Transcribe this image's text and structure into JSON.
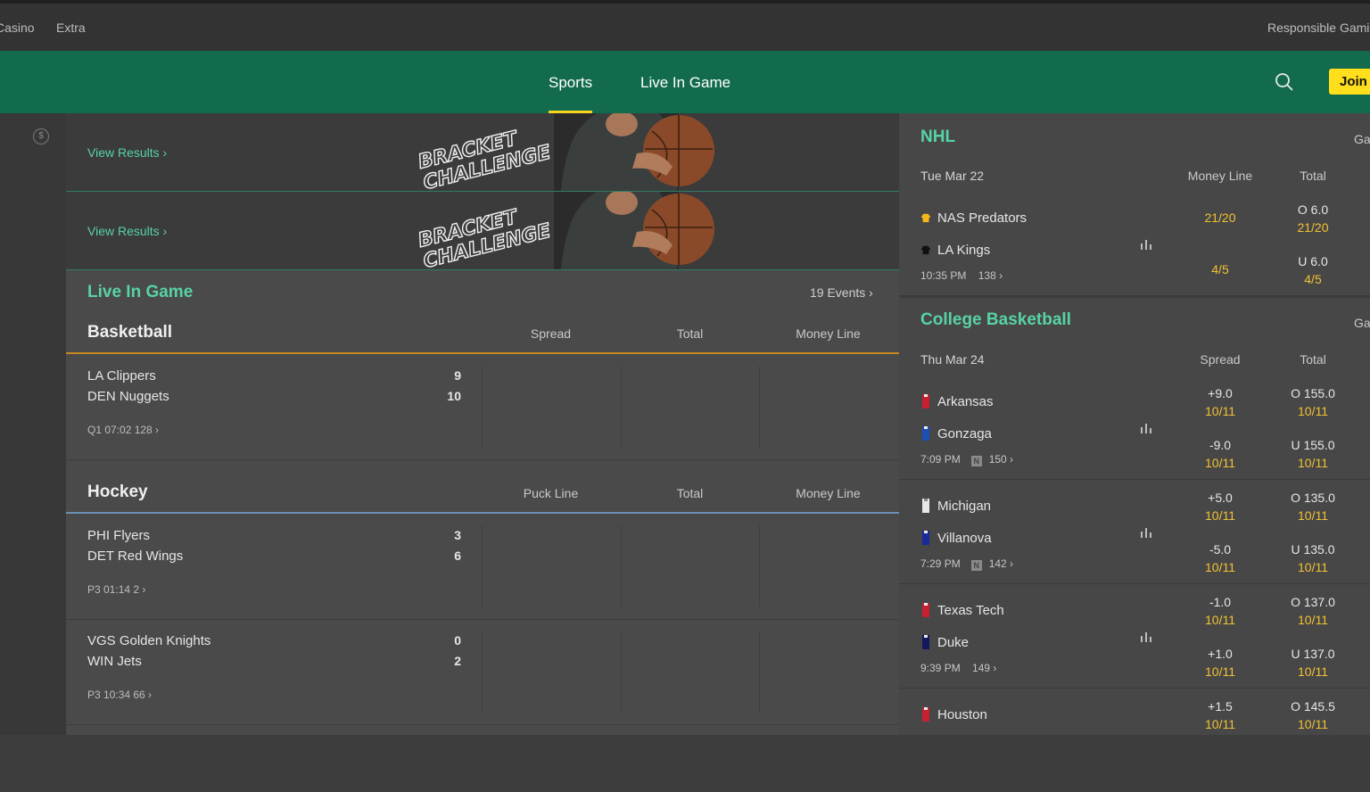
{
  "top_nav": {
    "casino": "Casino",
    "extra": "Extra",
    "responsible": "Responsible Gaming"
  },
  "green_bar": {
    "tabs": [
      "Sports",
      "Live In Game"
    ],
    "join": "Join"
  },
  "banners": [
    {
      "link": "View Results ›",
      "art_text": [
        "BRACKET",
        "CHALLENGE"
      ]
    },
    {
      "link": "View Results ›",
      "art_text": [
        "BRACKET",
        "CHALLENGE"
      ]
    }
  ],
  "live": {
    "title": "Live In Game",
    "events_count": "19 Events ›",
    "basketball": {
      "name": "Basketball",
      "cols": [
        "Spread",
        "Total",
        "Money Line"
      ],
      "events": [
        {
          "team1": "LA Clippers",
          "team2": "DEN Nuggets",
          "score1": "9",
          "score2": "10",
          "meta": "Q1 07:02    128 ›"
        }
      ]
    },
    "hockey": {
      "name": "Hockey",
      "cols": [
        "Puck Line",
        "Total",
        "Money Line"
      ],
      "events": [
        {
          "team1": "PHI Flyers",
          "team2": "DET Red Wings",
          "score1": "3",
          "score2": "6",
          "meta": "P3 01:14    2 ›"
        },
        {
          "team1": "VGS Golden Knights",
          "team2": "WIN Jets",
          "score1": "0",
          "score2": "2",
          "meta": "P3 10:34    66 ›"
        }
      ]
    }
  },
  "side": {
    "nhl": {
      "title": "NHL",
      "ga": "Ga",
      "date": "Tue Mar 22",
      "cols": [
        "Money Line",
        "Total"
      ],
      "game": {
        "team1": "NAS Predators",
        "team2": "LA Kings",
        "time": "10:35 PM",
        "count": "138 ›",
        "ml1": "21/20",
        "ml2": "4/5",
        "t1_line": "O 6.0",
        "t1_price": "21/20",
        "t2_line": "U 6.0",
        "t2_price": "4/5"
      }
    },
    "cbb": {
      "title": "College Basketball",
      "ga": "Ga",
      "date": "Thu Mar 24",
      "cols": [
        "Spread",
        "Total"
      ],
      "games": [
        {
          "team1": "Arkansas",
          "team2": "Gonzaga",
          "time": "7:09 PM",
          "neutral": "N",
          "count": "150 ›",
          "s1": "+9.0",
          "s1p": "10/11",
          "s2": "-9.0",
          "s2p": "10/11",
          "t1": "O 155.0",
          "t1p": "10/11",
          "t2": "U 155.0",
          "t2p": "10/11",
          "c1": "#c8202f",
          "c2": "#1d4fb5"
        },
        {
          "team1": "Michigan",
          "team2": "Villanova",
          "time": "7:29 PM",
          "neutral": "N",
          "count": "142 ›",
          "s1": "+5.0",
          "s1p": "10/11",
          "s2": "-5.0",
          "s2p": "10/11",
          "t1": "O 135.0",
          "t1p": "10/11",
          "t2": "U 135.0",
          "t2p": "10/11",
          "c1": "#e8e8e8",
          "c2": "#1a2a9a"
        },
        {
          "team1": "Texas Tech",
          "team2": "Duke",
          "time": "9:39 PM",
          "neutral": "",
          "count": "149 ›",
          "s1": "-1.0",
          "s1p": "10/11",
          "s2": "+1.0",
          "s2p": "10/11",
          "t1": "O 137.0",
          "t1p": "10/11",
          "t2": "U 137.0",
          "t2p": "10/11",
          "c1": "#c8202f",
          "c2": "#14185e"
        },
        {
          "team1": "Houston",
          "s1": "+1.5",
          "s1p": "10/11",
          "t1": "O 145.5",
          "t1p": "10/11",
          "c1": "#c8202f"
        }
      ]
    }
  },
  "colors": {
    "green": "#136b4e",
    "accent": "#57d3a4",
    "odds": "#f2c233",
    "join": "#ffdf1b",
    "basketball_rule": "#c7891f",
    "hockey_rule": "#6a8fb0"
  }
}
